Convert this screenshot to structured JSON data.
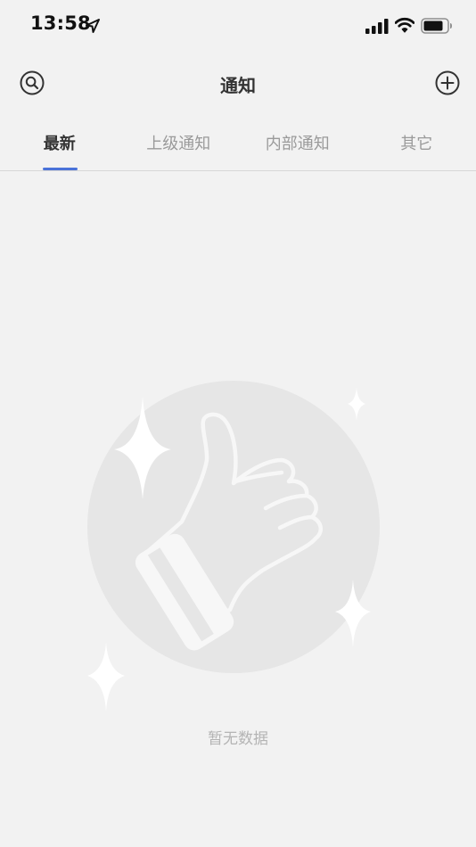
{
  "status_bar": {
    "time": "13:58",
    "icons": [
      "location-arrow-icon",
      "cellular-signal-icon",
      "wifi-icon",
      "battery-icon"
    ]
  },
  "header": {
    "title": "通知",
    "left_icon": "search-icon",
    "right_icon": "add-circle-icon"
  },
  "tabs": [
    {
      "label": "最新",
      "active": true
    },
    {
      "label": "上级通知",
      "active": false
    },
    {
      "label": "内部通知",
      "active": false
    },
    {
      "label": "其它",
      "active": false
    }
  ],
  "empty_state": {
    "message": "暂无数据",
    "icon": "thumbs-up-icon"
  },
  "colors": {
    "background": "#f2f2f2",
    "accent": "#4a72d9",
    "active_tab_text": "#333333",
    "inactive_tab_text": "#9a9a9a",
    "empty_text": "#b4b4b4"
  }
}
